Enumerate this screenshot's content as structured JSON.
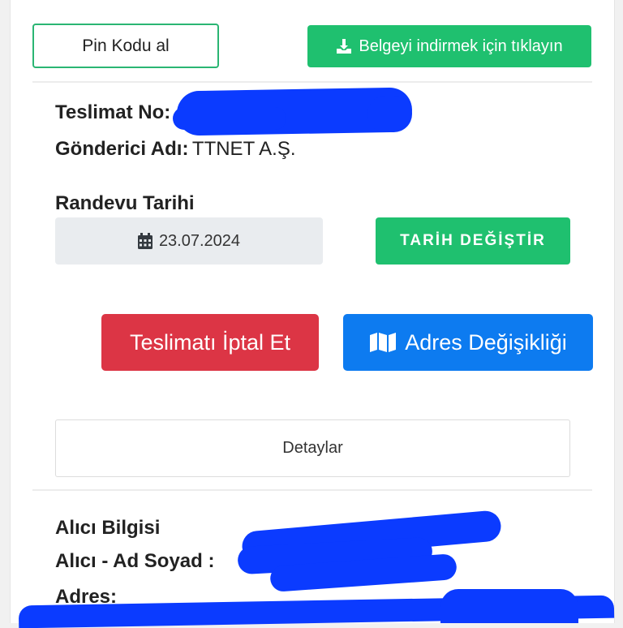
{
  "top_actions": {
    "pin_button": "Pin Kodu al",
    "download_button": "Belgeyi indirmek için tıklayın"
  },
  "delivery": {
    "number_label": "Teslimat No:",
    "sender_label": "Gönderici Adı:",
    "sender_value": "TTNET A.Ş."
  },
  "appointment": {
    "label": "Randevu Tarihi",
    "date": "23.07.2024",
    "change_button": "TARİH DEĞİŞTİR"
  },
  "actions": {
    "cancel_button": "Teslimatı İptal Et",
    "address_button": "Adres Değişikliği"
  },
  "details_button": "Detaylar",
  "recipient": {
    "heading": "Alıcı Bilgisi",
    "name_label": "Alıcı - Ad Soyad :",
    "address_label": "Adres:"
  },
  "icons": {
    "download": "download-icon",
    "calendar": "calendar-icon",
    "map": "map-icon"
  },
  "colors": {
    "green": "#1fc06f",
    "red": "#dc3545",
    "blue": "#0d7bf0",
    "redaction": "#0b3bff"
  }
}
